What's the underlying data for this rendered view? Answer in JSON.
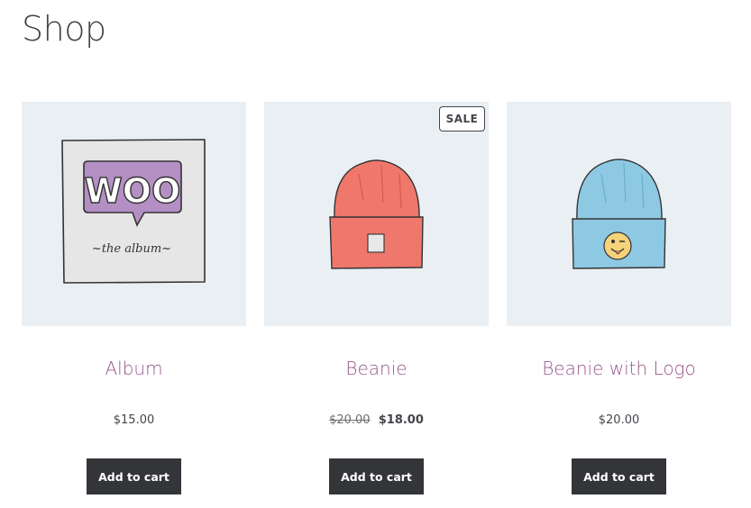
{
  "page": {
    "title": "Shop"
  },
  "products": [
    {
      "name": "Album",
      "price": "$15.00",
      "button": "Add to cart",
      "image_art": "WOO",
      "image_art_sub": "~the   album~"
    },
    {
      "name": "Beanie",
      "badge": "SALE",
      "regular_price": "$20.00",
      "sale_price": "$18.00",
      "button": "Add to cart"
    },
    {
      "name": "Beanie with Logo",
      "price": "$20.00",
      "button": "Add to cart"
    }
  ],
  "colors": {
    "title_text": "#43454b",
    "product_link": "#96588a",
    "thumb_bg": "#e9eff3",
    "button_bg": "#333539",
    "beanie_red": "#f0776b",
    "beanie_blue": "#8ec9e3",
    "album_purple": "#b48fc4"
  }
}
